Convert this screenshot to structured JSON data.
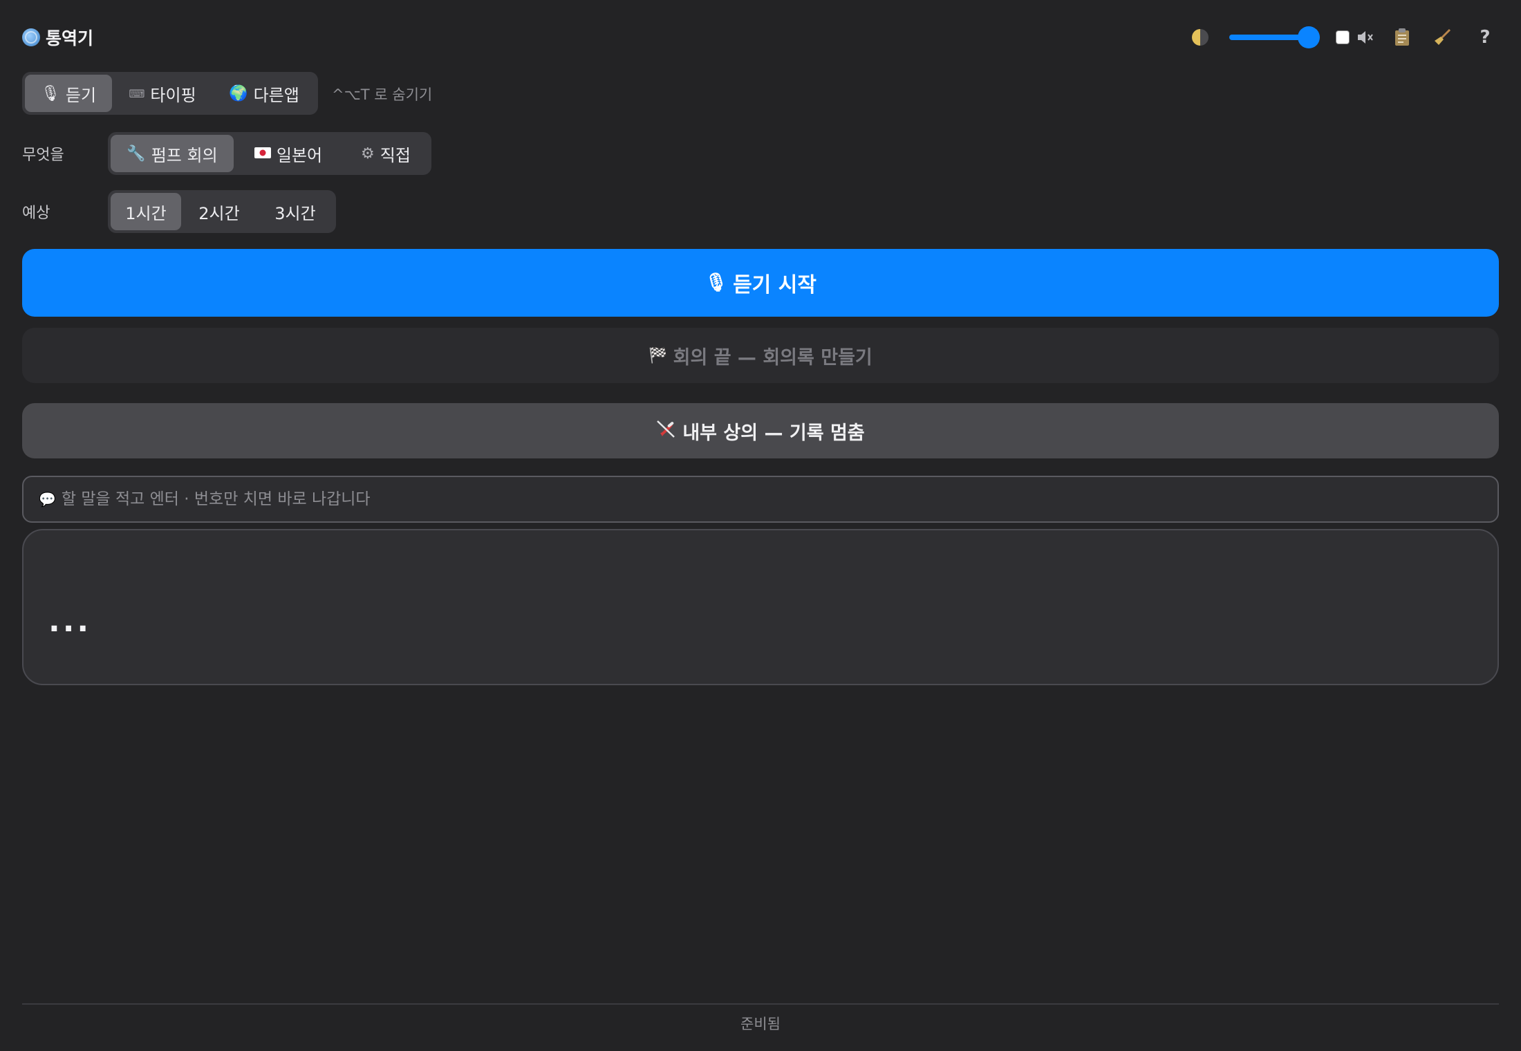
{
  "app": {
    "title": "통역기",
    "icon": "globe-icon"
  },
  "toolbar": {
    "contrast_icon": "contrast-icon",
    "volume_level_percent": 90,
    "mute_checked": false,
    "mute_icon": "speaker-mute-icon",
    "clipboard_icon": "clipboard-icon",
    "clear_icon": "broom-icon",
    "help_label": "?"
  },
  "mode_tabs": [
    {
      "label": "듣기",
      "icon": "microphone-icon",
      "active": true
    },
    {
      "label": "타이핑",
      "icon": "keyboard-icon",
      "active": false
    },
    {
      "label": "다른앱",
      "icon": "earth-icon",
      "active": false
    }
  ],
  "hide_hint": "^⌥T 로 숨기기",
  "what": {
    "label": "무엇을",
    "options": [
      {
        "label": "펌프 회의",
        "icon": "wrench-icon",
        "active": true
      },
      {
        "label": "일본어",
        "icon": "japan-flag-icon",
        "active": false
      },
      {
        "label": "직접",
        "icon": "gear-icon",
        "active": false
      }
    ]
  },
  "duration": {
    "label": "예상",
    "options": [
      {
        "label": "1시간",
        "active": true
      },
      {
        "label": "2시간",
        "active": false
      },
      {
        "label": "3시간",
        "active": false
      }
    ]
  },
  "buttons": {
    "start_listening": "듣기 시작",
    "end_meeting": "회의 끝 — 회의록 만들기",
    "internal_discussion": "내부 상의 — 기록 멈춤"
  },
  "input": {
    "placeholder": "할 말을 적고 엔터 · 번호만 치면 바로 나갑니다",
    "value": ""
  },
  "output": {
    "text": "..."
  },
  "status": "준비됨",
  "colors": {
    "accent": "#0a84ff",
    "background": "#232325"
  }
}
